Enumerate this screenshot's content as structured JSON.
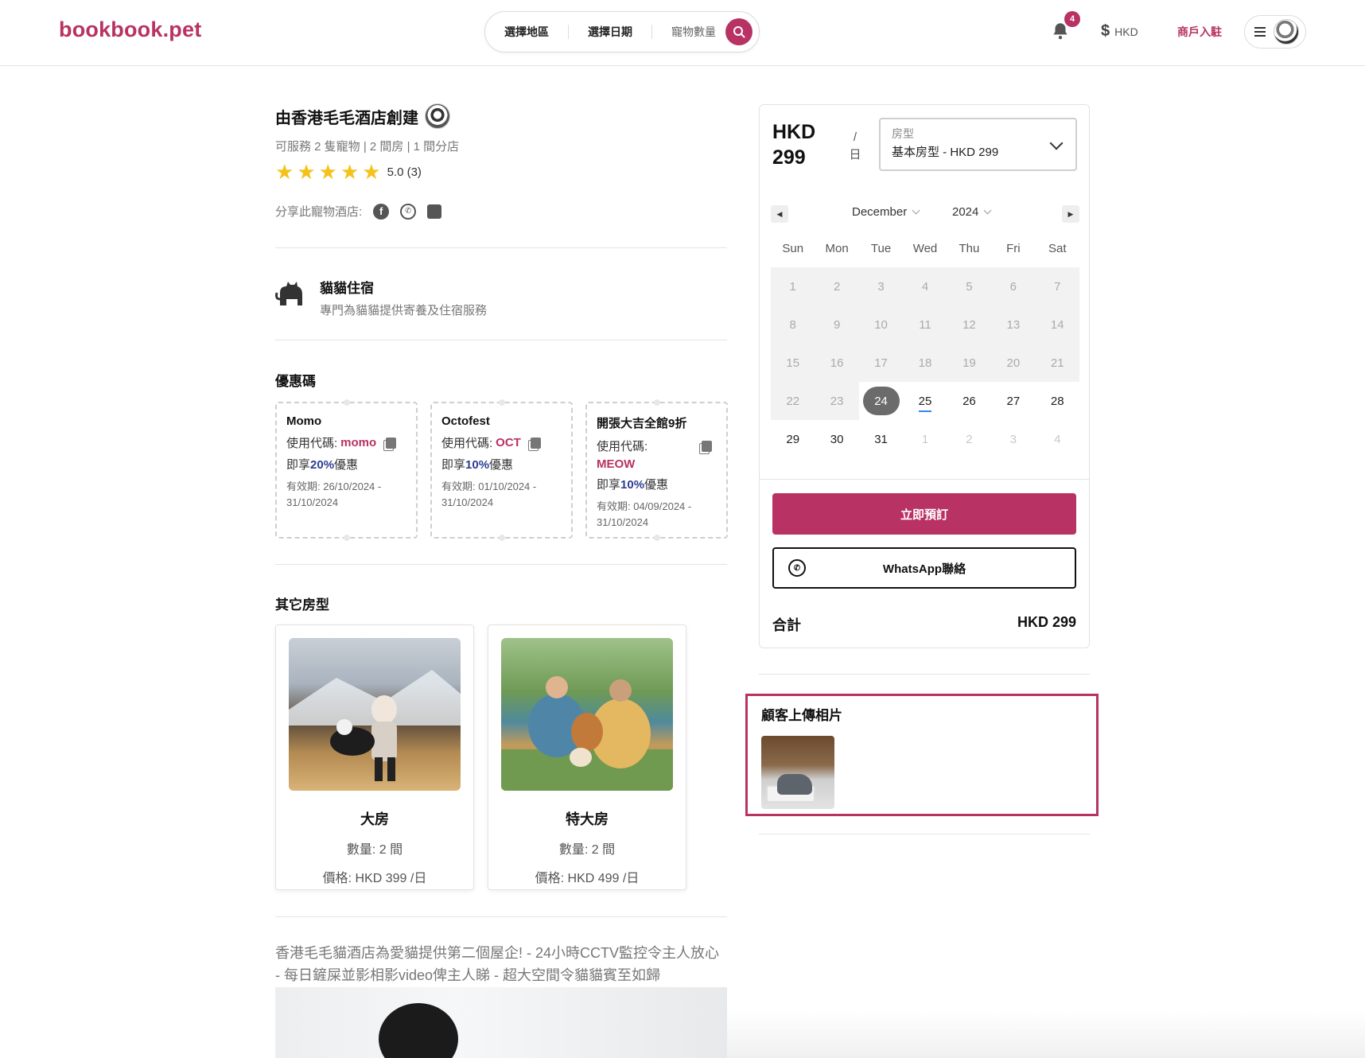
{
  "header": {
    "logo": "bookbook.pet",
    "search": {
      "region": "選擇地區",
      "date": "選擇日期",
      "pets": "寵物數量"
    },
    "notification_count": "4",
    "currency": "HKD",
    "merchant_link": "商戶入駐"
  },
  "hotel": {
    "title": "由香港毛毛酒店創建",
    "subinfo": "可服務 2 隻寵物 | 2 間房 | 1 間分店",
    "rating": "5.0 (3)",
    "share_label": "分享此寵物酒店:",
    "service": {
      "title": "貓貓住宿",
      "desc": "專門為貓貓提供寄養及住宿服務"
    },
    "coupons_title": "優惠碼",
    "coupons": [
      {
        "name": "Momo",
        "code_label": "使用代碼:",
        "code": "momo",
        "discount_prefix": "即享",
        "discount_pct": "20%",
        "discount_suffix": "優惠",
        "valid": "有效期: 26/10/2024 - 31/10/2024"
      },
      {
        "name": "Octofest",
        "code_label": "使用代碼:",
        "code": "OCT",
        "discount_prefix": "即享",
        "discount_pct": "10%",
        "discount_suffix": "優惠",
        "valid": "有效期: 01/10/2024 - 31/10/2024"
      },
      {
        "name": "開張大吉全館9折",
        "code_label": "使用代碼:",
        "code": "MEOW",
        "discount_prefix": "即享",
        "discount_pct": "10%",
        "discount_suffix": "優惠",
        "valid": "有效期: 04/09/2024 - 31/10/2024"
      }
    ],
    "other_rooms_title": "其它房型",
    "rooms": [
      {
        "name": "大房",
        "qty": "數量: 2 間",
        "price": "價格: HKD 399 /日"
      },
      {
        "name": "特大房",
        "qty": "數量: 2 間",
        "price": "價格: HKD 499 /日"
      }
    ],
    "description": "香港毛毛貓酒店為愛貓提供第二個屋企!  - 24小時CCTV監控令主人放心 - 每日鏟屎並影相影video俾主人睇 - 超大空間令貓貓賓至如歸"
  },
  "booking": {
    "price": "HKD 299",
    "per": "/ 日",
    "room_type_label": "房型",
    "room_type_value": "基本房型 - HKD 299",
    "month": "December",
    "year": "2024",
    "weekdays": [
      "Sun",
      "Mon",
      "Tue",
      "Wed",
      "Thu",
      "Fri",
      "Sat"
    ],
    "days": [
      {
        "d": "1",
        "s": "past"
      },
      {
        "d": "2",
        "s": "past"
      },
      {
        "d": "3",
        "s": "past"
      },
      {
        "d": "4",
        "s": "past"
      },
      {
        "d": "5",
        "s": "past"
      },
      {
        "d": "6",
        "s": "past"
      },
      {
        "d": "7",
        "s": "past"
      },
      {
        "d": "8",
        "s": "past"
      },
      {
        "d": "9",
        "s": "past"
      },
      {
        "d": "10",
        "s": "past"
      },
      {
        "d": "11",
        "s": "past"
      },
      {
        "d": "12",
        "s": "past"
      },
      {
        "d": "13",
        "s": "past"
      },
      {
        "d": "14",
        "s": "past"
      },
      {
        "d": "15",
        "s": "past"
      },
      {
        "d": "16",
        "s": "past"
      },
      {
        "d": "17",
        "s": "past"
      },
      {
        "d": "18",
        "s": "past"
      },
      {
        "d": "19",
        "s": "past"
      },
      {
        "d": "20",
        "s": "past"
      },
      {
        "d": "21",
        "s": "past"
      },
      {
        "d": "22",
        "s": "past"
      },
      {
        "d": "23",
        "s": "past"
      },
      {
        "d": "24",
        "s": "selected"
      },
      {
        "d": "25",
        "s": "today"
      },
      {
        "d": "26",
        "s": ""
      },
      {
        "d": "27",
        "s": ""
      },
      {
        "d": "28",
        "s": ""
      },
      {
        "d": "29",
        "s": ""
      },
      {
        "d": "30",
        "s": ""
      },
      {
        "d": "31",
        "s": ""
      },
      {
        "d": "1",
        "s": "other"
      },
      {
        "d": "2",
        "s": "other"
      },
      {
        "d": "3",
        "s": "other"
      },
      {
        "d": "4",
        "s": "other"
      }
    ],
    "book_button": "立即預訂",
    "whatsapp_button": "WhatsApp聯絡",
    "total_label": "合計",
    "total_value": "HKD 299"
  },
  "customer_photos": {
    "title": "顧客上傳相片"
  },
  "colors": {
    "brand": "#b83263",
    "discount": "#2c3e8f",
    "star": "#f4c21a"
  }
}
